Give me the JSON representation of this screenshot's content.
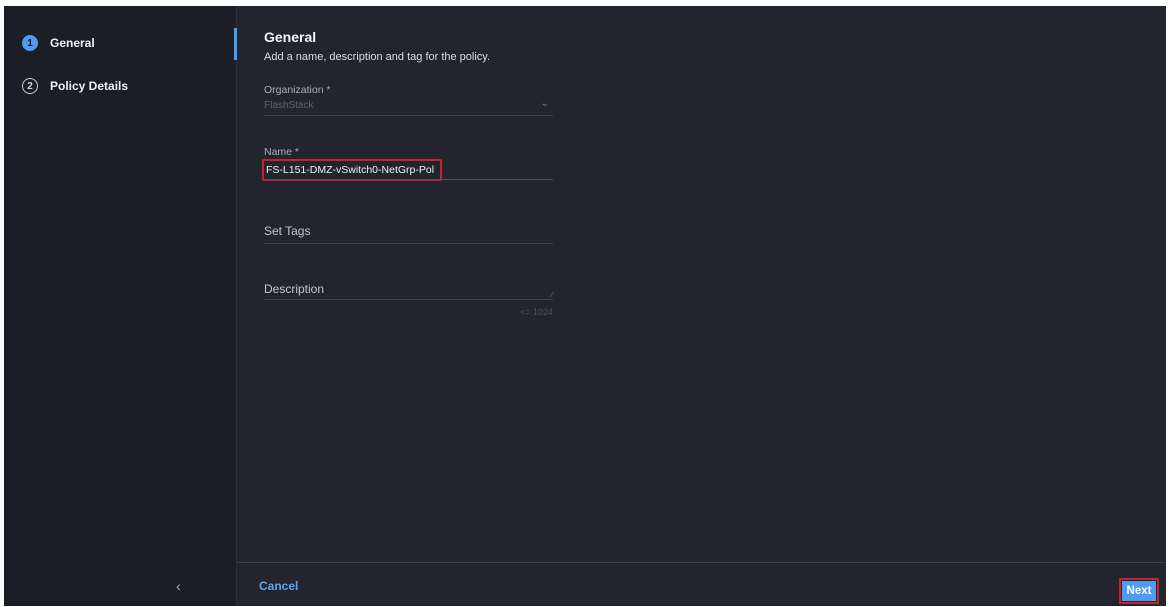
{
  "steps": [
    {
      "number": "1",
      "label": "General",
      "state": "active"
    },
    {
      "number": "2",
      "label": "Policy Details",
      "state": "inactive"
    }
  ],
  "sidebar": {
    "collapse_glyph": "‹"
  },
  "section": {
    "title": "General",
    "subtitle": "Add a name, description and tag for the policy."
  },
  "fields": {
    "organization": {
      "label": "Organization *",
      "value": "FlashStack",
      "icon": "chevron-down-icon"
    },
    "name": {
      "label": "Name *",
      "value": "FS-L151-DMZ-vSwitch0-NetGrp-Pol"
    },
    "tags": {
      "placeholder": "Set Tags"
    },
    "description": {
      "placeholder": "Description",
      "counter": "<= 1024"
    }
  },
  "footer": {
    "cancel_label": "Cancel",
    "next_label": "Next"
  },
  "colors": {
    "background": "#22252d",
    "sidebar": "#1b1e24",
    "accent": "#4f9bf1",
    "highlight": "#c8202d"
  }
}
